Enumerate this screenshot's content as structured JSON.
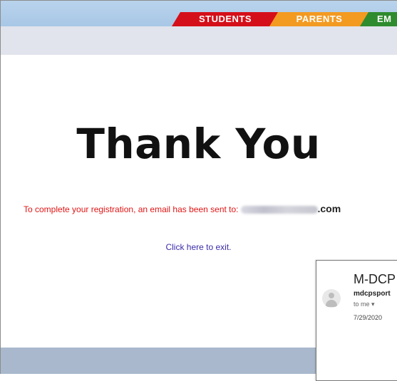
{
  "header": {
    "tabs": [
      {
        "label": "STUDENTS",
        "color": "#d50f19"
      },
      {
        "label": "PARENTS",
        "color": "#f39a21"
      },
      {
        "label": "EM",
        "color": "#2e8b2e"
      }
    ]
  },
  "main": {
    "heading": "Thank You",
    "registration_text": "To complete your registration, an email has been sent to:",
    "email_suffix": ".com",
    "exit_link": "Click here to exit."
  },
  "email_preview": {
    "subject": "M-DCP",
    "sender": "mdcpsport",
    "recipient": "to me",
    "dropdown_icon": "triangle-down-icon",
    "date": "7/29/2020",
    "avatar_icon": "person-icon"
  }
}
